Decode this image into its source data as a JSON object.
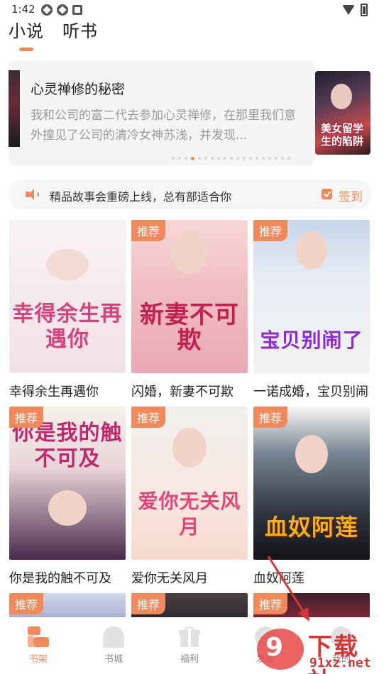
{
  "status_bar": {
    "time": "1:42"
  },
  "tabs": [
    {
      "label": "小说"
    },
    {
      "label": "听书"
    }
  ],
  "banner": {
    "title": "心灵禅修的秘密",
    "description": "我和公司的富二代去参加心灵禅修，在那里我们意外撞见了公司的清冷女神苏浅，并发现...",
    "right_cover_text": "美女留学生的陷阱",
    "dot_count": 19,
    "active_dot_index": 3
  },
  "notice": {
    "text": "精品故事会重磅上线，总有部适合你",
    "signin_label": "签到"
  },
  "badge_label": "推荐",
  "books": [
    {
      "title": "幸得余生再遇你",
      "cover_text": "幸得余生再遇你",
      "recommended": false
    },
    {
      "title": "闪婚，新妻不可欺",
      "cover_text": "新妻不可欺",
      "recommended": true
    },
    {
      "title": "一诺成婚，宝贝别闹了",
      "cover_text": "宝贝别闹了",
      "recommended": true
    },
    {
      "title": "你是我的触不可及",
      "cover_text": "你是我的触不可及",
      "recommended": true
    },
    {
      "title": "爱你无关风月",
      "cover_text": "爱你无关风月",
      "recommended": true
    },
    {
      "title": "血奴阿莲",
      "cover_text": "血奴阿莲",
      "recommended": true
    }
  ],
  "bottom_nav": [
    {
      "label": "书架",
      "icon": "bookshelf-icon",
      "active": true
    },
    {
      "label": "书城",
      "icon": "bookstore-icon",
      "active": false
    },
    {
      "label": "福利",
      "icon": "gift-icon",
      "active": false
    },
    {
      "label": "发现",
      "icon": "discover-icon",
      "active": false
    },
    {
      "label": "我的",
      "icon": "profile-icon",
      "active": false
    }
  ],
  "watermark": {
    "logo": "9",
    "text": "下载站",
    "domain": "91xz.net"
  },
  "colors": {
    "accent": "#f08a5d",
    "watermark_red": "#d33838"
  }
}
